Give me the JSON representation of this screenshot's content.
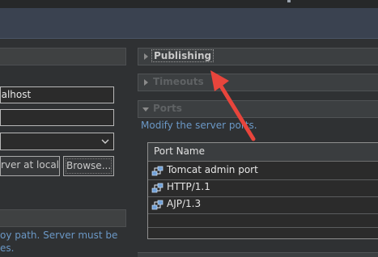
{
  "left": {
    "host_field": "calhost",
    "runtime_field": "",
    "select_value": "",
    "server_at_location_button": "rver at locall",
    "browse_button": "Browse...",
    "deploy_note_line1": "oy path. Server must be",
    "deploy_note_line2": "es."
  },
  "right": {
    "sections": [
      {
        "title": "Publishing",
        "state": "collapsed"
      },
      {
        "title": "Timeouts",
        "state": "collapsed"
      },
      {
        "title": "Ports",
        "state": "expanded"
      }
    ],
    "ports_description": "Modify the server ports.",
    "ports_table": {
      "header": "Port Name",
      "rows": [
        "Tomcat admin port",
        "HTTP/1.1",
        "AJP/1.3"
      ]
    }
  },
  "colors": {
    "annotation_arrow": "#e8453c",
    "link_text": "#6b98c6",
    "topbar": "#3a4250"
  },
  "icons": {
    "section_toggle": "triangle",
    "port_row": "network-port-icon",
    "select_dropdown": "chevron-down-icon"
  }
}
